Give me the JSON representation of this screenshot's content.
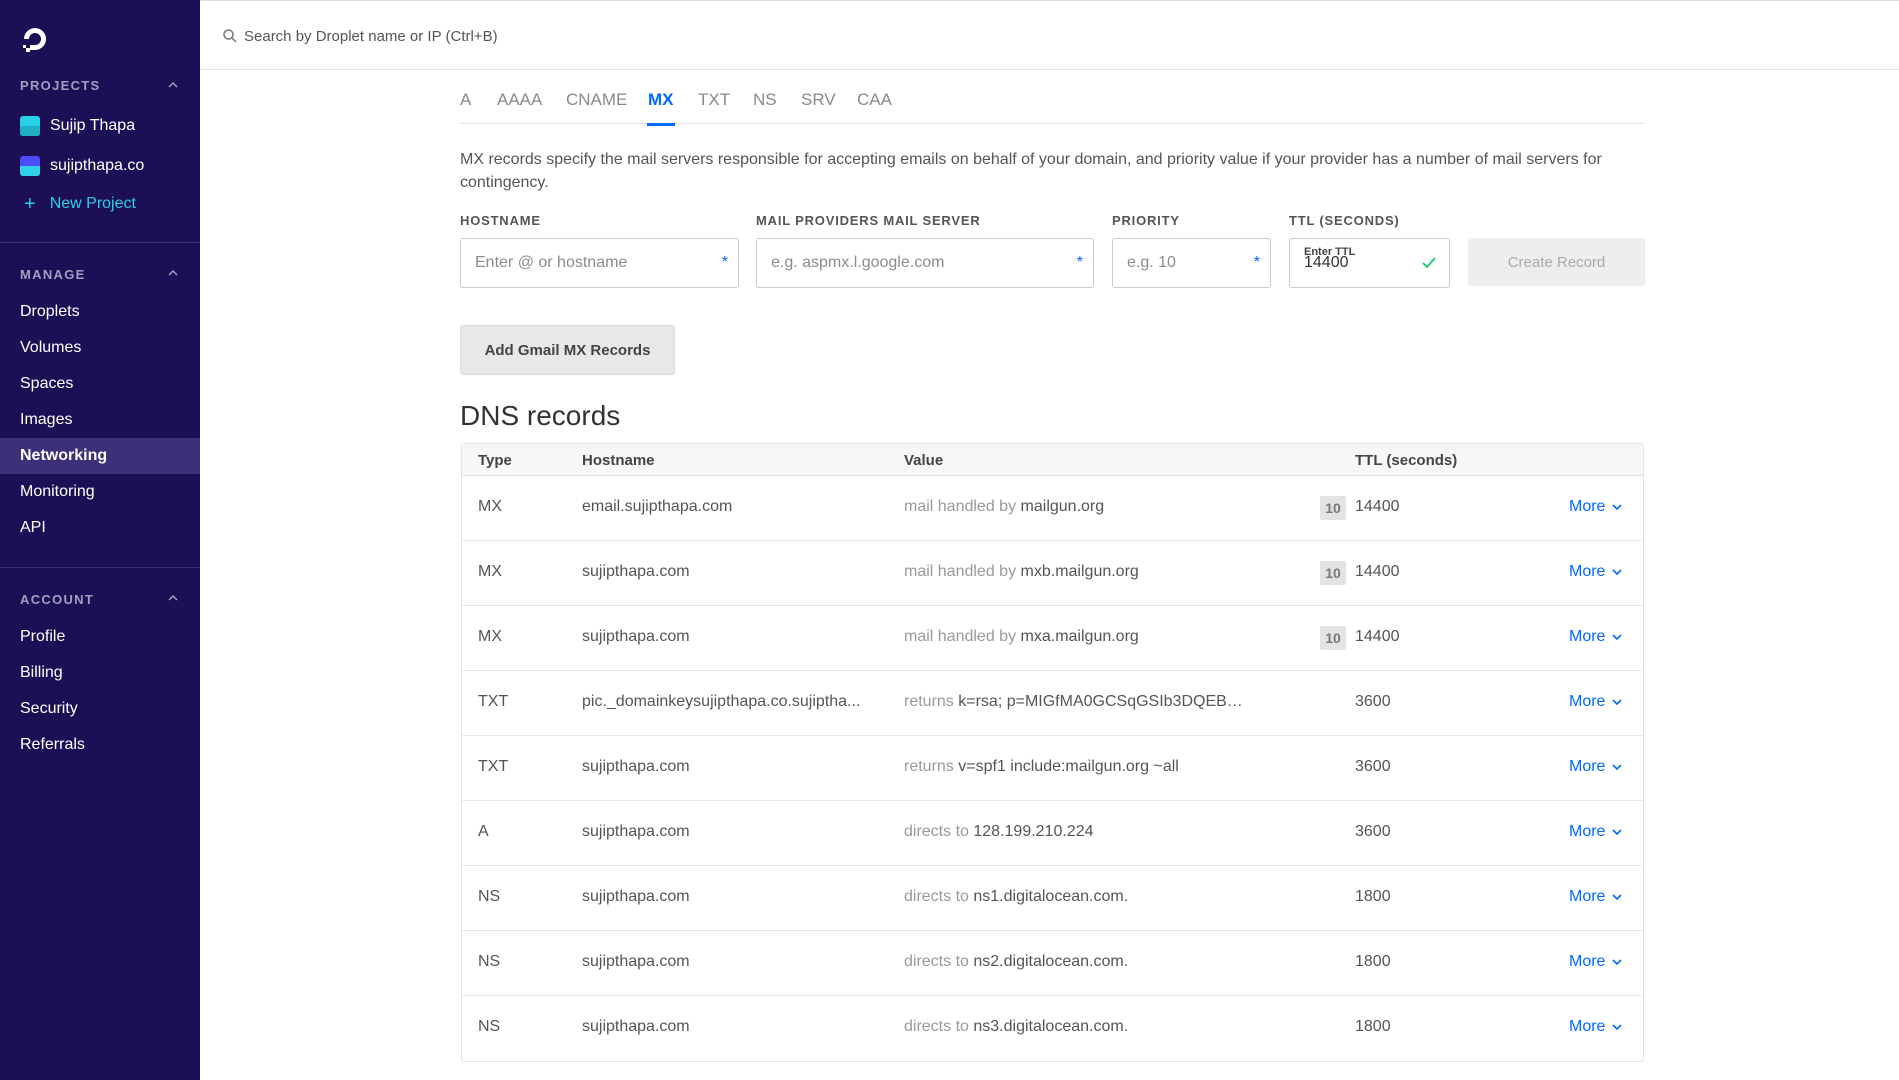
{
  "search": {
    "placeholder": "Search by Droplet name or IP (Ctrl+B)"
  },
  "sidebar": {
    "projects_header": "PROJECTS",
    "projects": [
      {
        "label": "Sujip Thapa",
        "color": "#27d1e6"
      },
      {
        "label": "sujipthapa.co",
        "color": "#4c4cff"
      }
    ],
    "new_project": "New Project",
    "manage_header": "MANAGE",
    "manage_items": [
      "Droplets",
      "Volumes",
      "Spaces",
      "Images",
      "Networking",
      "Monitoring",
      "API"
    ],
    "active_item": "Networking",
    "account_header": "ACCOUNT",
    "account_items": [
      "Profile",
      "Billing",
      "Security",
      "Referrals"
    ]
  },
  "tabs": [
    "A",
    "AAAA",
    "CNAME",
    "MX",
    "TXT",
    "NS",
    "SRV",
    "CAA"
  ],
  "active_tab": "MX",
  "description": "MX records specify the mail servers responsible for accepting emails on behalf of your domain, and priority value if your provider has a number of mail servers for contingency.",
  "form": {
    "hostname_label": "HOSTNAME",
    "hostname_placeholder": "Enter @ or hostname",
    "mailserver_label": "MAIL PROVIDERS MAIL SERVER",
    "mailserver_placeholder": "e.g. aspmx.l.google.com",
    "priority_label": "PRIORITY",
    "priority_placeholder": "e.g. 10",
    "ttl_label": "TTL (SECONDS)",
    "ttl_small": "Enter TTL",
    "ttl_value": "14400",
    "required_mark": "*",
    "create_button": "Create Record",
    "gmail_button": "Add Gmail MX Records"
  },
  "dns": {
    "title": "DNS records",
    "headers": {
      "type": "Type",
      "hostname": "Hostname",
      "value": "Value",
      "ttl": "TTL (seconds)"
    },
    "more_label": "More",
    "records": [
      {
        "type": "MX",
        "hostname": "email.sujipthapa.com",
        "prefix": "mail handled by",
        "value": "mailgun.org",
        "priority": "10",
        "ttl": "14400"
      },
      {
        "type": "MX",
        "hostname": "sujipthapa.com",
        "prefix": "mail handled by",
        "value": "mxb.mailgun.org",
        "priority": "10",
        "ttl": "14400"
      },
      {
        "type": "MX",
        "hostname": "sujipthapa.com",
        "prefix": "mail handled by",
        "value": "mxa.mailgun.org",
        "priority": "10",
        "ttl": "14400"
      },
      {
        "type": "TXT",
        "hostname": "pic._domainkeysujipthapa.co.sujiptha...",
        "prefix": "returns",
        "value": "k=rsa; p=MIGfMA0GCSqGSIb3DQEBA...",
        "priority": "",
        "ttl": "3600"
      },
      {
        "type": "TXT",
        "hostname": "sujipthapa.com",
        "prefix": "returns",
        "value": "v=spf1 include:mailgun.org ~all",
        "priority": "",
        "ttl": "3600"
      },
      {
        "type": "A",
        "hostname": "sujipthapa.com",
        "prefix": "directs to",
        "value": "128.199.210.224",
        "priority": "",
        "ttl": "3600"
      },
      {
        "type": "NS",
        "hostname": "sujipthapa.com",
        "prefix": "directs to",
        "value": "ns1.digitalocean.com.",
        "priority": "",
        "ttl": "1800"
      },
      {
        "type": "NS",
        "hostname": "sujipthapa.com",
        "prefix": "directs to",
        "value": "ns2.digitalocean.com.",
        "priority": "",
        "ttl": "1800"
      },
      {
        "type": "NS",
        "hostname": "sujipthapa.com",
        "prefix": "directs to",
        "value": "ns3.digitalocean.com.",
        "priority": "",
        "ttl": "1800"
      }
    ]
  },
  "colors": {
    "sidebar_bg": "#1d0f55",
    "accent": "#0069ff",
    "new_project": "#27d1e6"
  }
}
